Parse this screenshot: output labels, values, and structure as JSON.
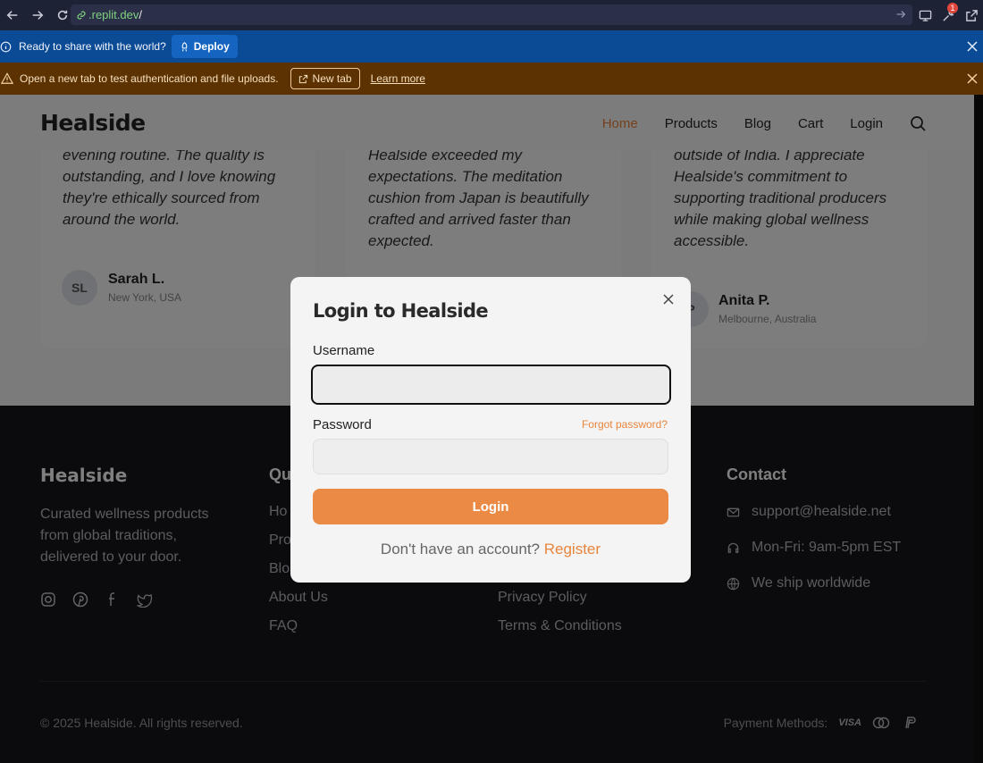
{
  "browser": {
    "url_domain": ".replit.dev",
    "url_path": "/",
    "notifications_count": "1"
  },
  "banner_deploy": {
    "text": "Ready to share with the world?",
    "deploy_label": "Deploy"
  },
  "banner_auth": {
    "text": "Open a new tab to test authentication and file uploads.",
    "new_tab_label": "New tab",
    "learn_more_label": "Learn more"
  },
  "site": {
    "logo": "Healside",
    "nav": [
      "Home",
      "Products",
      "Blog",
      "Cart",
      "Login"
    ],
    "active_nav": "Home"
  },
  "testimonials": [
    {
      "quote": "Healside have transformed my evening routine. The quality is outstanding, and I love knowing they're ethically sourced from around the world.",
      "initials": "SL",
      "name": "Sarah L.",
      "location": "New York, USA"
    },
    {
      "quote": "wellness products online, but Healside exceeded my expectations. The meditation cushion from Japan is beautifully crafted and arrived faster than expected.",
      "initials": "",
      "name": "",
      "location": ""
    },
    {
      "quote": "is the most authentic I've tried outside of India. I appreciate Healside's commitment to supporting traditional producers while making global wellness accessible.",
      "initials": "P",
      "name": "Anita P.",
      "location": "Melbourne, Australia"
    }
  ],
  "footer": {
    "logo": "Healside",
    "description": "Curated wellness products from global traditions, delivered to your door.",
    "quick_links_title": "Qu",
    "quick_links": [
      "Ho",
      "Pro",
      "Blo",
      "About Us",
      "FAQ"
    ],
    "legal_links": [
      "Privacy Policy",
      "Terms & Conditions"
    ],
    "contact_title": "Contact",
    "contact": {
      "email": "support@healside.net",
      "hours": "Mon-Fri: 9am-5pm EST",
      "shipping": "We ship worldwide"
    },
    "copyright": "© 2025 Healside. All rights reserved.",
    "payment_label": "Payment Methods:",
    "payment_visa": "VISA"
  },
  "modal": {
    "title": "Login to Healside",
    "username_label": "Username",
    "username_value": "",
    "password_label": "Password",
    "forgot_label": "Forgot password?",
    "login_label": "Login",
    "no_account_text": "Don't have an account?",
    "register_label": "Register"
  },
  "colors": {
    "accent": "#e8853d",
    "login_button": "#ea8a45",
    "deploy_banner": "#0b4b95",
    "auth_banner": "#5c3300"
  }
}
